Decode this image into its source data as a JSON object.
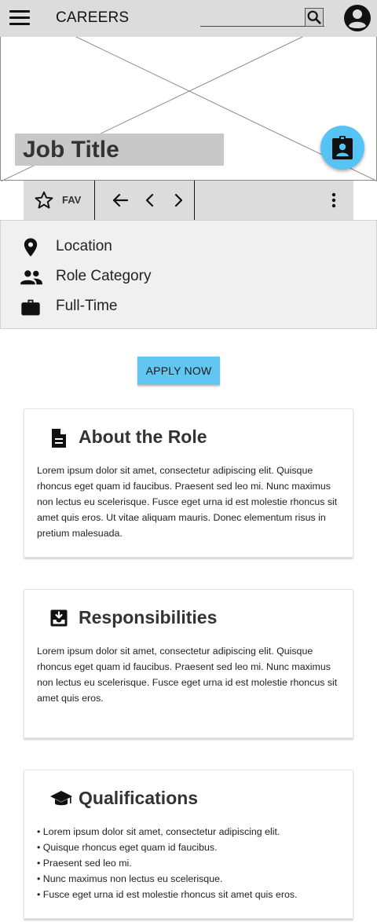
{
  "header": {
    "title": "CAREERS",
    "search_placeholder": "",
    "icons": {
      "menu": "menu-icon",
      "search": "search-icon",
      "account": "account-circle-icon"
    }
  },
  "hero": {
    "job_title": "Job Title",
    "fab_icon": "assignment-ind-icon"
  },
  "toolbar": {
    "fav_label": "FAV",
    "icons": [
      "star-outline-icon",
      "arrow-left-icon",
      "chevron-left-icon",
      "chevron-right-icon",
      "more-vertical-icon"
    ]
  },
  "info": {
    "items": [
      {
        "icon": "location-pin-icon",
        "label": "Location"
      },
      {
        "icon": "people-icon",
        "label": "Role Category"
      },
      {
        "icon": "briefcase-icon",
        "label": "Full-Time"
      }
    ]
  },
  "apply_button": "APPLY NOW",
  "sections": [
    {
      "icon": "document-icon",
      "title": "About the Role",
      "body": "Lorem ipsum dolor sit amet, consectetur adipiscing elit. Quisque rhoncus eget quam id faucibus. Praesent sed leo mi. Nunc maximus non lectus eu scelerisque. Fusce eget urna id est molestie rhoncus sit amet quis eros. Ut vitae aliquam mauris. Donec elementum risus in pretium malesuada."
    },
    {
      "icon": "inbox-download-icon",
      "title": "Responsibilities",
      "body": "Lorem ipsum dolor sit amet, consectetur adipiscing elit. Quisque rhoncus eget quam id faucibus. Praesent sed leo mi. Nunc maximus non lectus eu scelerisque. Fusce eget urna id est molestie rhoncus sit amet quis eros."
    },
    {
      "icon": "graduation-cap-icon",
      "title": "Qualifications",
      "bullets": [
        "Lorem ipsum dolor sit amet, consectetur adipiscing elit.",
        "Quisque rhoncus eget quam id faucibus.",
        "Praesent sed leo mi.",
        "Nunc maximus non lectus eu scelerisque.",
        "Fusce eget urna id est molestie rhoncus sit amet quis eros."
      ]
    }
  ]
}
